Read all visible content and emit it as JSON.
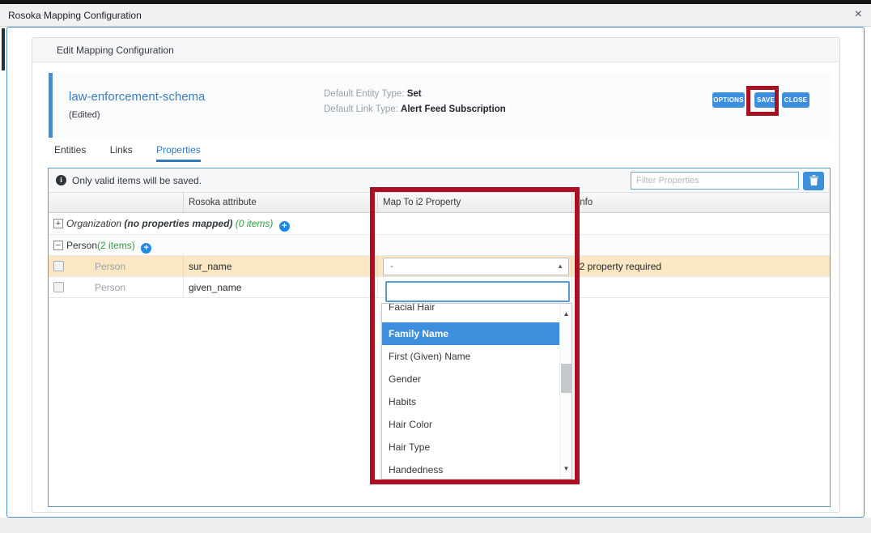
{
  "window": {
    "title": "Rosoka Mapping Configuration",
    "close": "×"
  },
  "panel": {
    "title": "Edit Mapping Configuration"
  },
  "schema": {
    "name": "law-enforcement-schema",
    "status": "(Edited)",
    "entity_type_label": "Default Entity Type:",
    "entity_type_value": "Set",
    "link_type_label": "Default Link Type:",
    "link_type_value": "Alert Feed Subscription",
    "options_button": "OPTIONS",
    "save_button": "SAVE",
    "close_button": "CLOSE"
  },
  "tabs": {
    "entities": "Entities",
    "links": "Links",
    "properties": "Properties",
    "active": "Properties"
  },
  "table": {
    "notice": "Only valid items will be saved.",
    "filter_placeholder": "Filter Properties",
    "columns": {
      "c1": "Rosoka attribute",
      "c2": "Map To i2 Property",
      "c3": "Info"
    },
    "groups": {
      "organization": {
        "name": "Organization",
        "suffix": "(no properties mapped)",
        "count": "(0 items)",
        "icon": "+"
      },
      "person": {
        "name": "Person",
        "count": "(2 items)",
        "icon": "−"
      }
    },
    "rows": [
      {
        "entity": "Person",
        "attribute": "sur_name",
        "selected_value": "-",
        "info": "i2 property required"
      },
      {
        "entity": "Person",
        "attribute": "given_name",
        "selected_value": "",
        "info": ""
      }
    ]
  },
  "dropdown": {
    "search_value": "",
    "items": [
      "Facial Hair",
      "Family Name",
      "First (Given) Name",
      "Gender",
      "Habits",
      "Hair Color",
      "Hair Type",
      "Handedness"
    ],
    "highlighted": "Family Name"
  },
  "colors": {
    "accent_blue": "#3e8ede",
    "annotation_red": "#a91122",
    "selected_row": "#fbe7c3",
    "active_tab": "#2f79c0",
    "count_green": "#2f9e44"
  }
}
